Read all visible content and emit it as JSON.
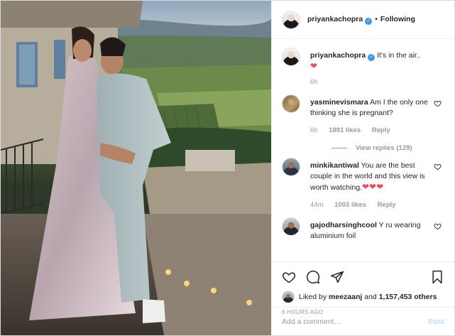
{
  "header": {
    "username": "priyankachopra",
    "separator": "•",
    "follow_label": "Following"
  },
  "caption": {
    "username": "priyankachopra",
    "text": "It's in the air..",
    "heart": "❤",
    "time": "6h"
  },
  "comments": [
    {
      "username": "yasminevismara",
      "text": "Am I the only one thinking she is pregnant?",
      "time": "6h",
      "likes": "1891 likes",
      "reply_label": "Reply",
      "view_replies": "View replies (129)"
    },
    {
      "username": "minkikantiwal",
      "text": "You are the best couple in the world and this view is worth watching.",
      "hearts": "❤❤❤",
      "time": "44m",
      "likes": "1003 likes",
      "reply_label": "Reply"
    },
    {
      "username": "gajodharsinghcool",
      "text": "Y ru wearing aluminium foil"
    }
  ],
  "likes_summary": {
    "prefix": "Liked by",
    "user": "meezaanj",
    "middle": "and",
    "count": "1,157,453 others"
  },
  "timestamp": "6 HOURS AGO",
  "add_comment": {
    "placeholder": "Add a comment…",
    "post_label": "Post"
  },
  "icons": [
    "heart-icon",
    "comment-icon",
    "share-icon",
    "bookmark-icon",
    "verified-icon",
    "comment-like-heart-icon"
  ],
  "colors": {
    "verified": "#3897f0",
    "heart_red": "#ed4956",
    "muted": "#999999",
    "post_disabled": "#b2dffc"
  }
}
